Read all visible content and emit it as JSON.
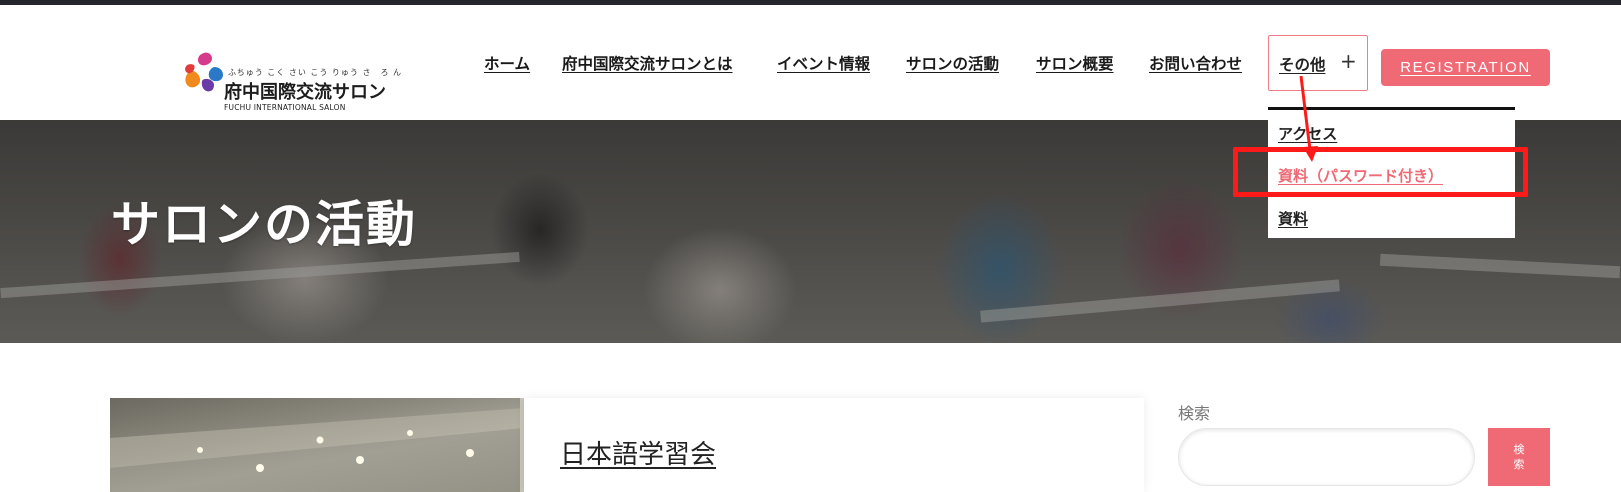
{
  "logo": {
    "ruby": "ふちゅう こく さい こう りゅう さ　ろ ん",
    "name_jp": "府中国際交流サロン",
    "name_en": "FUCHU INTERNATIONAL SALON"
  },
  "nav": {
    "items": [
      {
        "label": "ホーム"
      },
      {
        "label": "府中国際交流サロンとは"
      },
      {
        "label": "イベント情報"
      },
      {
        "label": "サロンの活動"
      },
      {
        "label": "サロン概要"
      },
      {
        "label": "お問い合わせ"
      }
    ],
    "other": {
      "label": "その他",
      "plus": "+"
    },
    "registration": "REGISTRATION"
  },
  "dropdown": {
    "items": [
      {
        "label": "アクセス"
      },
      {
        "label": "資料（パスワード付き）"
      },
      {
        "label": "資料"
      }
    ]
  },
  "hero": {
    "title": "サロンの活動"
  },
  "post": {
    "title": "日本語学習会"
  },
  "sidebar": {
    "search_label": "検索",
    "search_value": "",
    "search_button": "検索"
  },
  "colors": {
    "accent": "#ef6a75",
    "annotation": "#ff1a1a",
    "topbar": "#24262b"
  }
}
